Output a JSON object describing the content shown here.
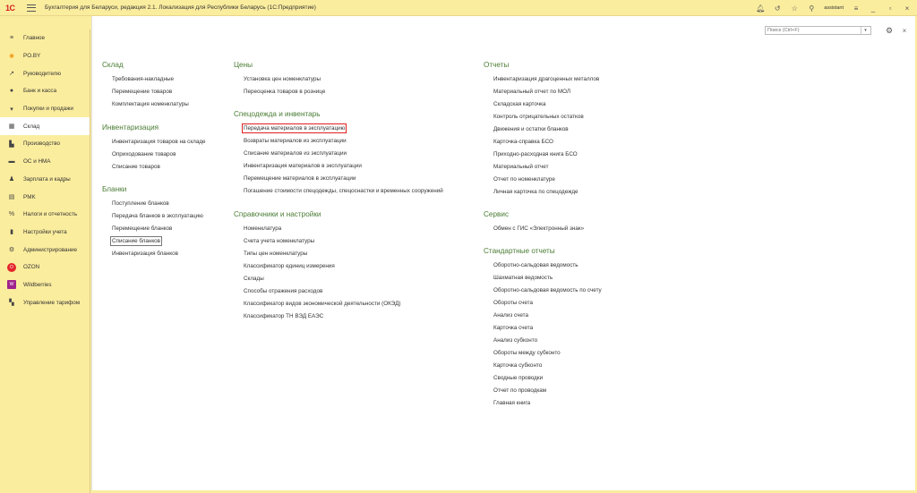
{
  "window": {
    "logo_text": "1С",
    "title": "Бухгалтерия для Беларуси, редакция 2.1. Локализация для Республики Беларусь   (1С:Предприятие)",
    "username": "assistant"
  },
  "sidebar": {
    "items": [
      {
        "label": "Главное",
        "icon": "≡"
      },
      {
        "label": "PO.BY",
        "icon": "✳"
      },
      {
        "label": "Руководителю",
        "icon": "↗"
      },
      {
        "label": "Банк и касса",
        "icon": "●"
      },
      {
        "label": "Покупки и продажи",
        "icon": "▾"
      },
      {
        "label": "Склад",
        "icon": "▦"
      },
      {
        "label": "Производство",
        "icon": "▙"
      },
      {
        "label": "ОС и НМА",
        "icon": "▬"
      },
      {
        "label": "Зарплата и кадры",
        "icon": "♟"
      },
      {
        "label": "PMK",
        "icon": "▤"
      },
      {
        "label": "Налоги и отчетность",
        "icon": "%"
      },
      {
        "label": "Настройки учета",
        "icon": "▮"
      },
      {
        "label": "Администрирование",
        "icon": "⚙"
      },
      {
        "label": "OZON",
        "icon": "O"
      },
      {
        "label": "Wildberries",
        "icon": "W"
      },
      {
        "label": "Управление тарифом",
        "icon": "▚"
      }
    ]
  },
  "search": {
    "placeholder": "Поиск (Ctrl+F)",
    "dropdown": "▾"
  },
  "icons": {
    "gear": "⚙",
    "close": "×"
  },
  "content": {
    "sklad": {
      "title": "Склад",
      "links": [
        "Требования-накладные",
        "Перемещение товаров",
        "Комплектация номенклатуры"
      ]
    },
    "inventarizatsiya": {
      "title": "Инвентаризация",
      "links": [
        "Инвентаризация товаров на складе",
        "Оприходование товаров",
        "Списание товаров"
      ]
    },
    "blanki": {
      "title": "Бланки",
      "links": [
        "Поступление бланков",
        "Передача бланков в эксплуатацию",
        "Перемещение бланков",
        "Списание бланков",
        "Инвентаризация бланков"
      ]
    },
    "tseny": {
      "title": "Цены",
      "links": [
        "Установка цен номенклатуры",
        "Переоценка товаров в рознице"
      ]
    },
    "specodezhda": {
      "title": "Спецодежда и инвентарь",
      "links": [
        "Передача материалов в эксплуатацию",
        "Возвраты материалов из эксплуатации",
        "Списание материалов из эксплуатации",
        "Инвентаризация материалов в эксплуатации",
        "Перемещение материалов в эксплуатации",
        "Погашение стоимости спецодежды, спецоснастки и временных сооружений"
      ]
    },
    "spravochniki": {
      "title": "Справочники и настройки",
      "links": [
        "Номенклатура",
        "Счета учета номенклатуры",
        "Типы цен номенклатуры",
        "Классификатор единиц измерения",
        "Склады",
        "Способы отражения расходов",
        "Классификатор видов экономической деятельности (ОКЭД)",
        "Классификатор ТН ВЭД ЕАЭС"
      ]
    },
    "otchety": {
      "title": "Отчеты",
      "links": [
        "Инвентаризация драгоценных металлов",
        "Материальный отчет по МОЛ",
        "Складская карточка",
        "Контроль отрицательных остатков",
        "Движения и остатки бланков",
        "Карточка-справка БСО",
        "Приходно-расходная книга БСО",
        "Материальный отчет",
        "Отчет по номенклатуре",
        "Личная карточка по спецодежде"
      ]
    },
    "servis": {
      "title": "Сервис",
      "links": [
        "Обмен с ГИС «Электронный знак»"
      ]
    },
    "standartnye": {
      "title": "Стандартные отчеты",
      "links": [
        "Оборотно-сальдовая ведомость",
        "Шахматная ведомость",
        "Оборотно-сальдовая ведомость по счету",
        "Обороты счета",
        "Анализ счета",
        "Карточка счета",
        "Анализ субконто",
        "Обороты между субконто",
        "Карточка субконто",
        "Сводные проводки",
        "Отчет по проводкам",
        "Главная книга"
      ]
    }
  },
  "colors": {
    "accent_yellow": "#fbed9e",
    "section_green": "#4a7c34",
    "highlight_red": "#e02020"
  }
}
